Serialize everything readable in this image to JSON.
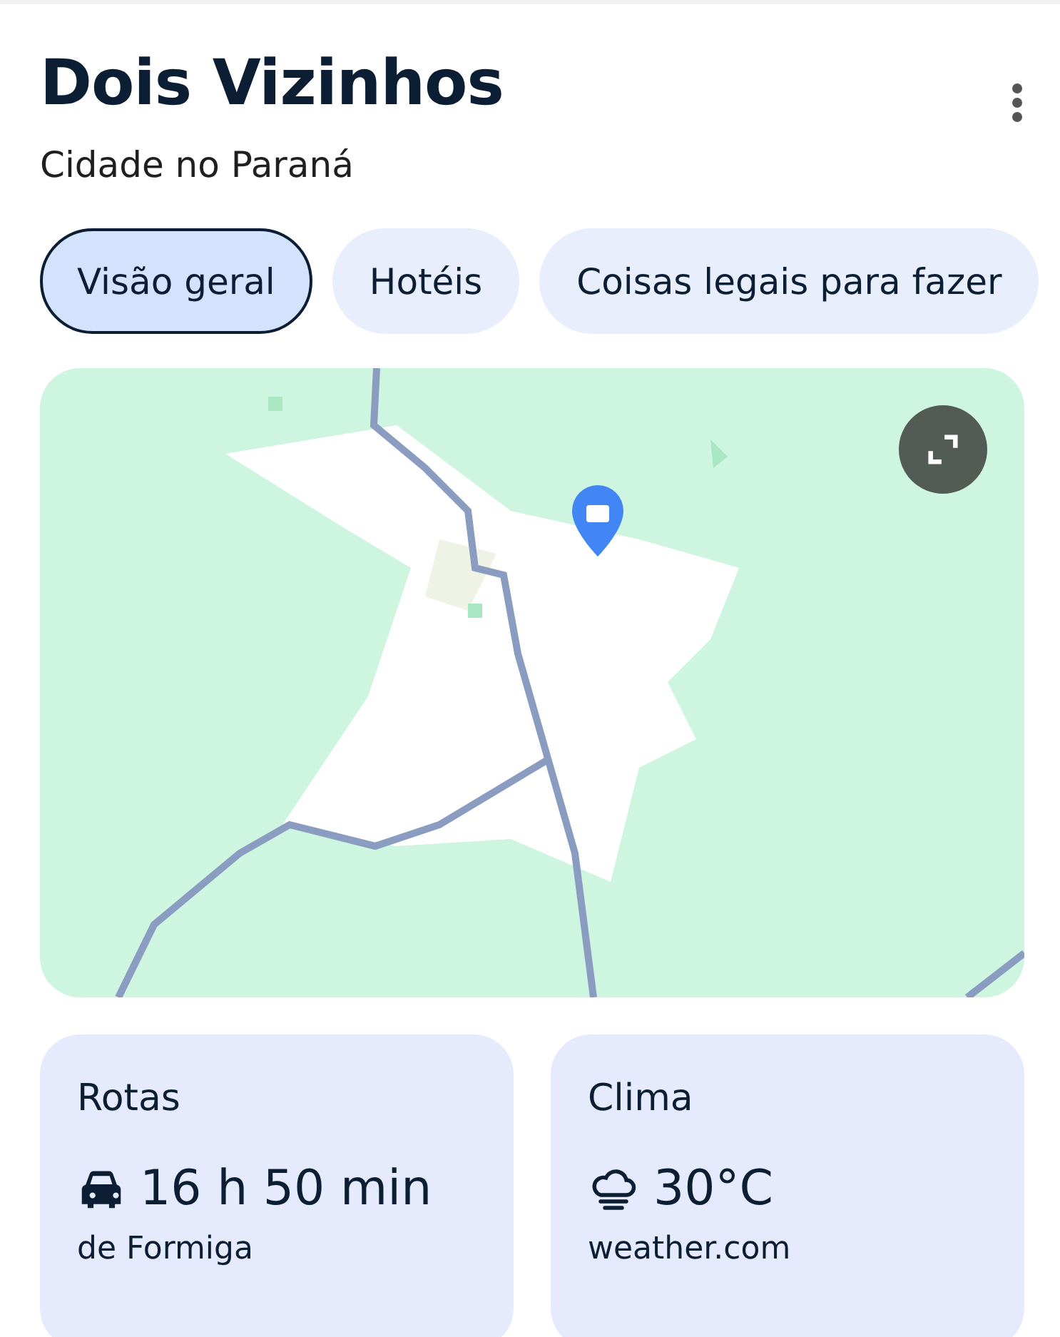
{
  "header": {
    "title": "Dois Vizinhos",
    "subtitle": "Cidade no Paraná"
  },
  "tabs": [
    {
      "label": "Visão geral",
      "selected": true
    },
    {
      "label": "Hotéis",
      "selected": false
    },
    {
      "label": "Coisas legais para fazer",
      "selected": false
    }
  ],
  "cards": [
    {
      "kind": "route",
      "title": "Rotas",
      "value": "16 h 50 min",
      "source": "de Formiga"
    },
    {
      "kind": "weather",
      "title": "Clima",
      "value": "30°C",
      "source": "weather.com"
    }
  ]
}
